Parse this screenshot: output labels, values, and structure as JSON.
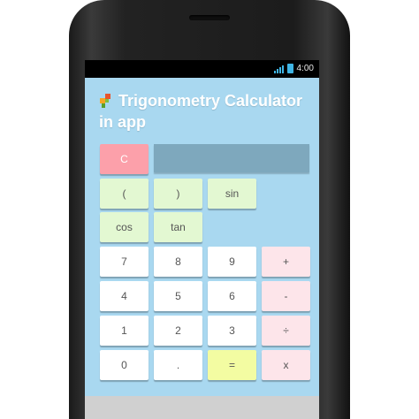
{
  "status_bar": {
    "time": "4:00",
    "signal_icon": "signal-icon",
    "battery_icon": "battery-icon"
  },
  "app": {
    "title": "Trigonometry Calculator in app",
    "icon": "app-logo-icon"
  },
  "display": {
    "value": ""
  },
  "keys": {
    "clear": "C",
    "open_paren": "(",
    "close_paren": ")",
    "sin": "sin",
    "cos": "cos",
    "tan": "tan",
    "seven": "7",
    "eight": "8",
    "nine": "9",
    "plus": "+",
    "four": "4",
    "five": "5",
    "six": "6",
    "minus": "-",
    "one": "1",
    "two": "2",
    "three": "3",
    "divide": "÷",
    "zero": "0",
    "dot": ".",
    "equals": "=",
    "multiply": "x"
  },
  "colors": {
    "app_background": "#a9d8f0",
    "display_background": "#7ea8bd",
    "clear_key": "#fca0aa",
    "function_key": "#e3f8d2",
    "operator_key": "#fde5ea",
    "equals_key": "#f3fca2",
    "digit_key": "#ffffff",
    "status_accent": "#3fb5e5"
  }
}
